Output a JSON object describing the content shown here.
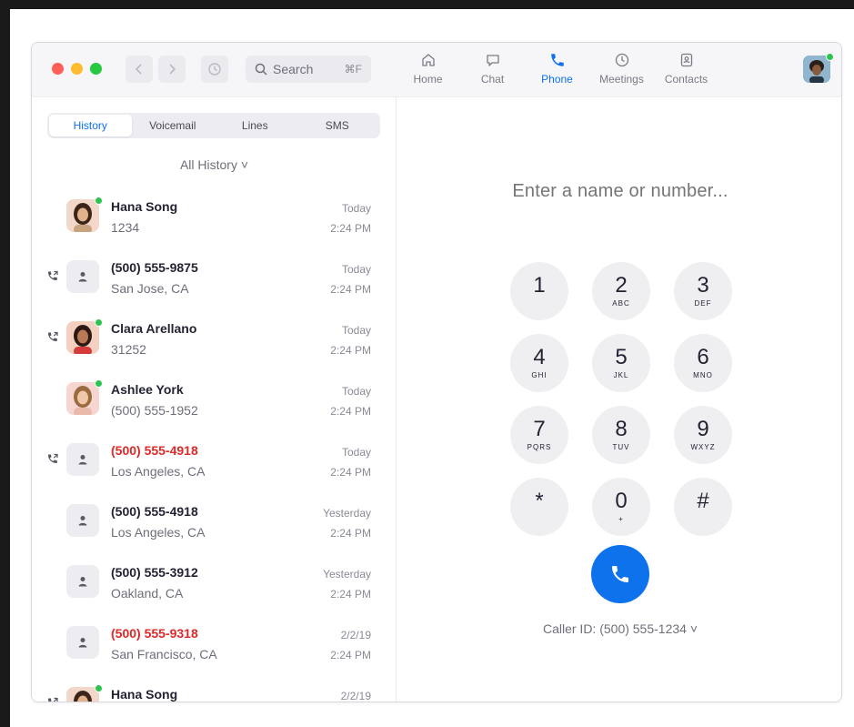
{
  "toolbar": {
    "search_placeholder": "Search",
    "search_shortcut": "⌘F",
    "back_icon": "chevron-left-icon",
    "forward_icon": "chevron-right-icon",
    "history_icon": "clock-icon"
  },
  "nav_tabs": [
    {
      "label": "Home",
      "icon": "home-icon",
      "active": false
    },
    {
      "label": "Chat",
      "icon": "chat-bubble-icon",
      "active": false
    },
    {
      "label": "Phone",
      "icon": "phone-icon",
      "active": true
    },
    {
      "label": "Meetings",
      "icon": "clock-icon",
      "active": false
    },
    {
      "label": "Contacts",
      "icon": "contact-card-icon",
      "active": false
    }
  ],
  "segments": [
    {
      "label": "History",
      "active": true
    },
    {
      "label": "Voicemail",
      "active": false
    },
    {
      "label": "Lines",
      "active": false
    },
    {
      "label": "SMS",
      "active": false
    }
  ],
  "filter_label": "All History ˅",
  "calls": [
    {
      "name": "Hana Song",
      "sub": "1234",
      "date": "Today",
      "time": "2:24 PM",
      "missed": false,
      "avatar": "photo",
      "online": true,
      "direction_icon": false
    },
    {
      "name": "(500) 555-9875",
      "sub": "San Jose, CA",
      "date": "Today",
      "time": "2:24 PM",
      "missed": false,
      "avatar": "generic",
      "online": false,
      "direction_icon": true
    },
    {
      "name": "Clara Arellano",
      "sub": "31252",
      "date": "Today",
      "time": "2:24 PM",
      "missed": false,
      "avatar": "photo",
      "online": true,
      "direction_icon": true
    },
    {
      "name": "Ashlee York",
      "sub": "(500) 555-1952",
      "date": "Today",
      "time": "2:24 PM",
      "missed": false,
      "avatar": "photo",
      "online": true,
      "direction_icon": false
    },
    {
      "name": "(500) 555-4918",
      "sub": "Los Angeles, CA",
      "date": "Today",
      "time": "2:24 PM",
      "missed": true,
      "avatar": "generic",
      "online": false,
      "direction_icon": true
    },
    {
      "name": "(500) 555-4918",
      "sub": "Los Angeles, CA",
      "date": "Yesterday",
      "time": "2:24 PM",
      "missed": false,
      "avatar": "generic",
      "online": false,
      "direction_icon": false
    },
    {
      "name": "(500) 555-3912",
      "sub": "Oakland, CA",
      "date": "Yesterday",
      "time": "2:24 PM",
      "missed": false,
      "avatar": "generic",
      "online": false,
      "direction_icon": false
    },
    {
      "name": "(500) 555-9318",
      "sub": "San Francisco, CA",
      "date": "2/2/19",
      "time": "2:24 PM",
      "missed": true,
      "avatar": "generic",
      "online": false,
      "direction_icon": false
    },
    {
      "name": "Hana Song",
      "sub": "",
      "date": "2/2/19",
      "time": "",
      "missed": false,
      "avatar": "photo",
      "online": true,
      "direction_icon": true
    }
  ],
  "dialer": {
    "placeholder": "Enter a name or number...",
    "keys": [
      {
        "digit": "1",
        "letters": ""
      },
      {
        "digit": "2",
        "letters": "ABC"
      },
      {
        "digit": "3",
        "letters": "DEF"
      },
      {
        "digit": "4",
        "letters": "GHI"
      },
      {
        "digit": "5",
        "letters": "JKL"
      },
      {
        "digit": "6",
        "letters": "MNO"
      },
      {
        "digit": "7",
        "letters": "PQRS"
      },
      {
        "digit": "8",
        "letters": "TUV"
      },
      {
        "digit": "9",
        "letters": "WXYZ"
      },
      {
        "digit": "*",
        "letters": ""
      },
      {
        "digit": "0",
        "letters": "+"
      },
      {
        "digit": "#",
        "letters": ""
      }
    ],
    "caller_id": "Caller ID: (500) 555-1234 ˅",
    "call_icon": "phone-icon"
  },
  "colors": {
    "accent": "#0e72ed",
    "missed": "#e02828",
    "online": "#2bc44f"
  }
}
